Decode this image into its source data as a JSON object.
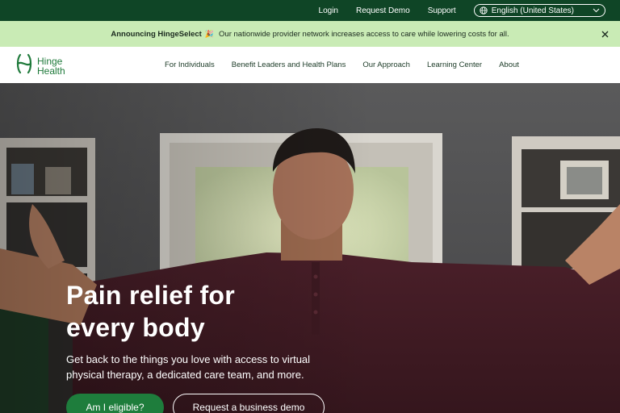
{
  "utility_nav": {
    "links": [
      {
        "label": "Login"
      },
      {
        "label": "Request Demo"
      },
      {
        "label": "Support"
      }
    ],
    "language": {
      "selected": "English (United States)",
      "icon": "globe-icon"
    }
  },
  "announcement": {
    "bold": "Announcing HingeSelect",
    "emoji": "🎉",
    "text": "Our nationwide provider network increases access to care while lowering costs for all.",
    "close_icon": "close-icon"
  },
  "brand": {
    "line1": "Hinge",
    "line2": "Health",
    "color": "#1f7a3b"
  },
  "main_nav": {
    "items": [
      {
        "label": "For Individuals"
      },
      {
        "label": "Benefit Leaders and Health Plans"
      },
      {
        "label": "Our Approach"
      },
      {
        "label": "Learning Center"
      },
      {
        "label": "About"
      }
    ]
  },
  "hero": {
    "title_line1": "Pain relief for",
    "title_line2": "every body",
    "subtitle": "Get back to the things you love with access to virtual physical therapy, a dedicated care team, and more.",
    "primary_cta": "Am I eligible?",
    "secondary_cta": "Request a business demo"
  },
  "colors": {
    "utility_bg": "#0f4526",
    "announcement_bg": "#c9ebb5",
    "primary_button": "#1e7d3c"
  }
}
